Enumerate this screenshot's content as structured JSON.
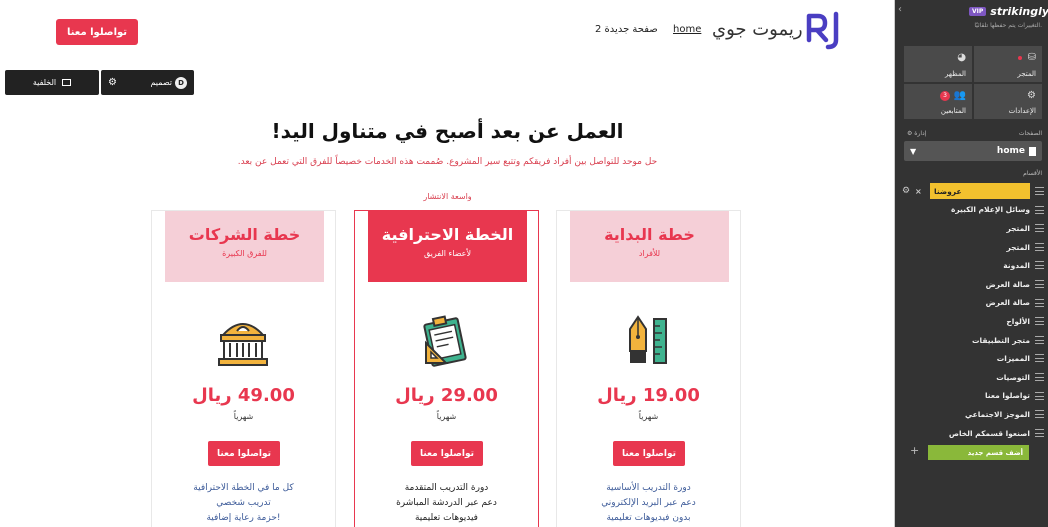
{
  "site": {
    "contact_btn": "تواصلوا معنا",
    "nav_home": "home",
    "nav_page2": "صفحة جديدة 2",
    "brand_name": "ريموت جوي",
    "logo_text": "RJ"
  },
  "toolbar": {
    "background_label": "الخلفية",
    "design_label": "تصميم",
    "design_badge": "D"
  },
  "pricing": {
    "title": "العمل عن بعد أصبح في متناول اليد!",
    "subtitle": "حل موحد للتواصل بين أفراد فريقكم وتتبع سير المشروع. صُممت هذه الخدمات خصيصاً للفرق التي تعمل عن بعد.",
    "badge": "واسعة الانتشار",
    "plans": [
      {
        "title": "خطة الشركات",
        "subtitle": "للفرق الكبيرة",
        "price": "49.00 ريال",
        "period": "شهرياً",
        "button": "تواصلوا معنا",
        "features": [
          "كل ما في الخطة الاحترافية",
          "تدريب شخصي",
          "حزمة رعاية إضافية!"
        ],
        "icon": "building-icon"
      },
      {
        "title": "الخطة الاحترافية",
        "subtitle": "لأعضاء الفريق",
        "price": "29.00 ريال",
        "period": "شهرياً",
        "button": "تواصلوا معنا",
        "features": [
          "دورة التدريب المتقدمة",
          "دعم عبر الدردشة المباشرة",
          "فيديوهات تعليمية"
        ],
        "icon": "clipboard-ruler-icon"
      },
      {
        "title": "خطة البداية",
        "subtitle": "للأفراد",
        "price": "19.00 ريال",
        "period": "شهرياً",
        "button": "تواصلوا معنا",
        "features": [
          "دورة التدريب الأساسية",
          "دعم عبر البريد الإلكتروني",
          "بدون فيديوهات تعليمية"
        ],
        "icon": "pen-ruler-icon"
      }
    ]
  },
  "sidebar": {
    "logo": "strikingly",
    "vip": "VIP",
    "note": "التغييرات يتم حفظها تلقائيًا.",
    "tiles": {
      "appearance": "المظهر",
      "store": "المتجر",
      "followers": "المتابعين",
      "followers_count": "3",
      "settings": "الإعدادات"
    },
    "pages_label": "الصفحات",
    "manage_label": "إدارة",
    "current_page": "home",
    "sections_label": "الأقسام",
    "sections": [
      "عروضنا",
      "وسائل الإعلام الكبيرة",
      "المتجر",
      "المتجر",
      "المدونة",
      "صالة العرض",
      "صالة العرض",
      "الألواح",
      "متجر التطبيقات",
      "المميزات",
      "التوصيات",
      "تواصلوا معنا",
      "الموجز الاجتماعي",
      "اصنعوا قسمكم الخاص"
    ],
    "add_section": "أضف قسم جديد"
  }
}
